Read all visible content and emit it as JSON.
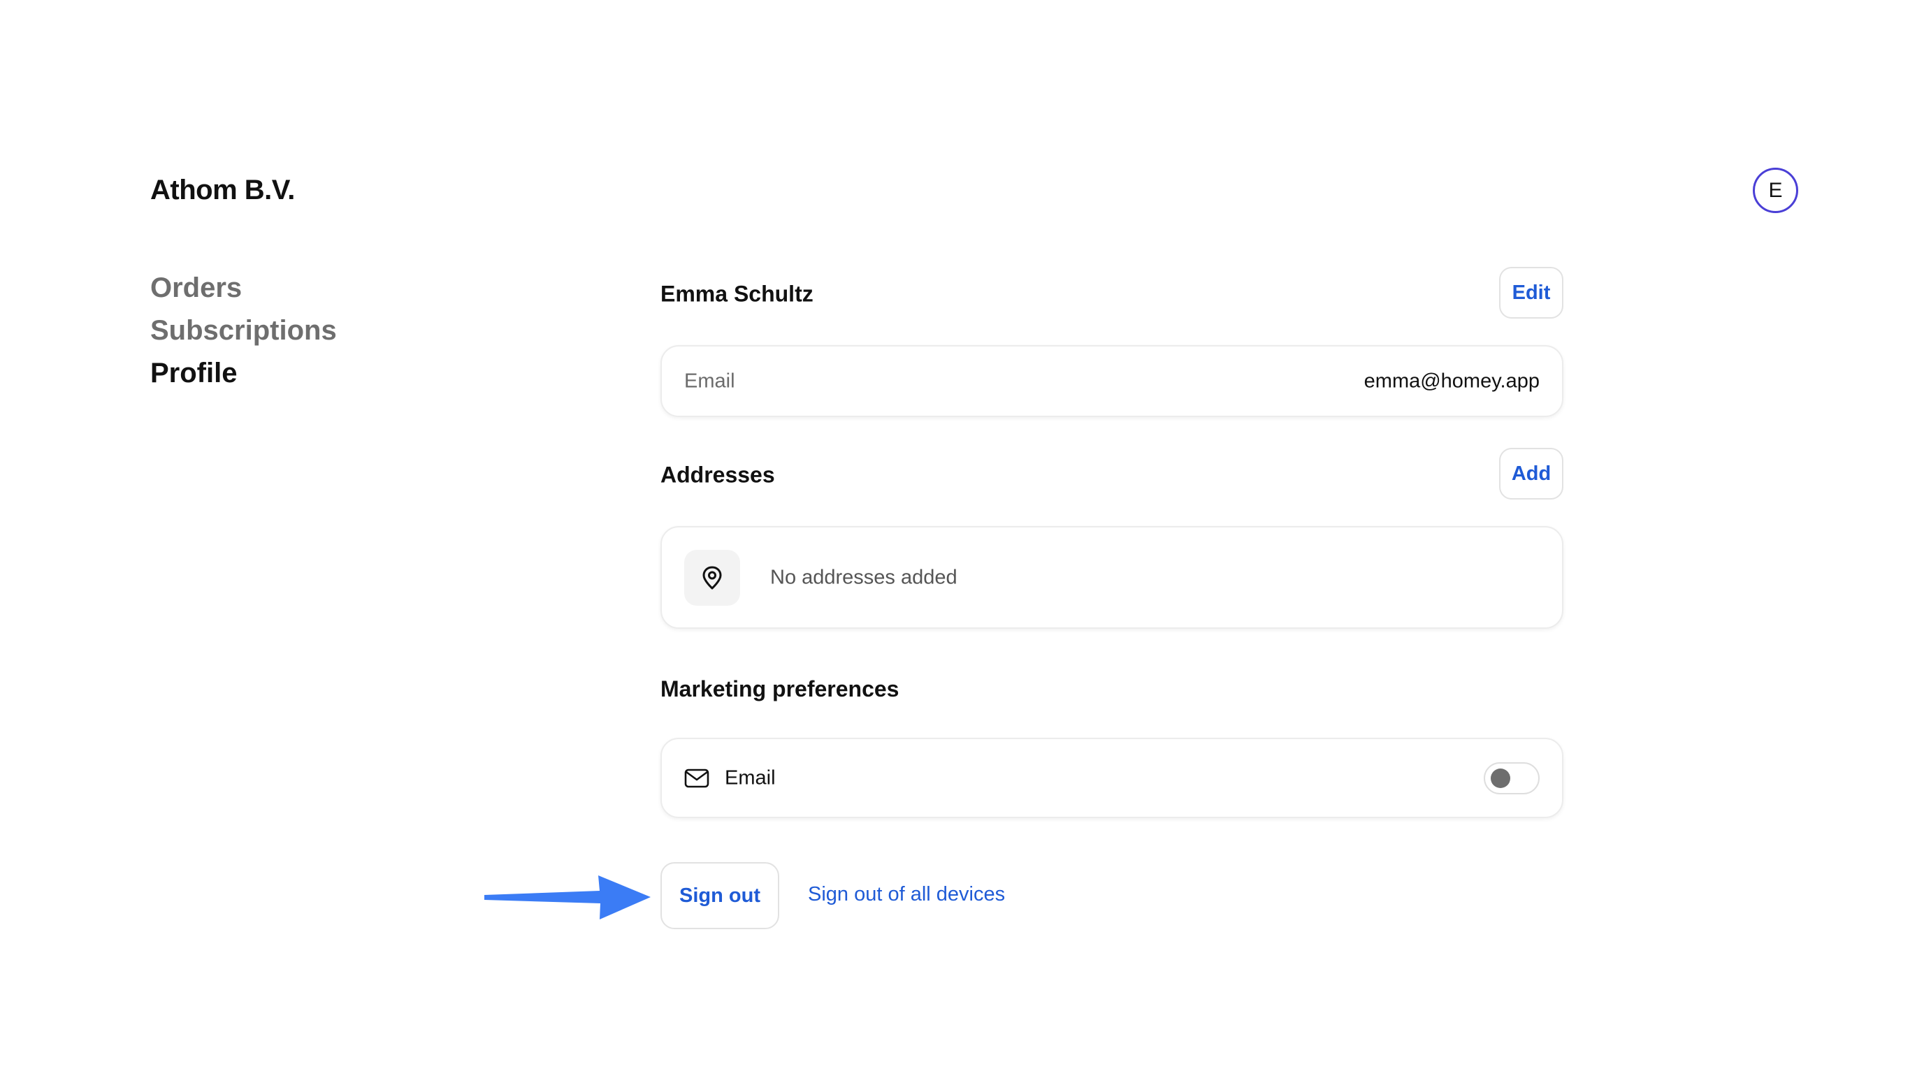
{
  "header": {
    "brand": "Athom B.V.",
    "avatar_initial": "E"
  },
  "sidebar": {
    "items": [
      {
        "label": "Orders",
        "active": false
      },
      {
        "label": "Subscriptions",
        "active": false
      },
      {
        "label": "Profile",
        "active": true
      }
    ]
  },
  "profile": {
    "name": "Emma Schultz",
    "edit_label": "Edit",
    "email_label": "Email",
    "email_value": "emma@homey.app"
  },
  "addresses": {
    "title": "Addresses",
    "add_label": "Add",
    "empty_text": "No addresses added",
    "icon": "map-pin-icon"
  },
  "marketing": {
    "title": "Marketing preferences",
    "email_label": "Email",
    "email_enabled": false,
    "icon": "mail-icon"
  },
  "actions": {
    "sign_out_label": "Sign out",
    "sign_out_all_label": "Sign out of all devices"
  },
  "colors": {
    "accent": "#1f5bd6",
    "avatar_ring": "#4a3fd6",
    "annotation_arrow": "#3b7cf5"
  }
}
